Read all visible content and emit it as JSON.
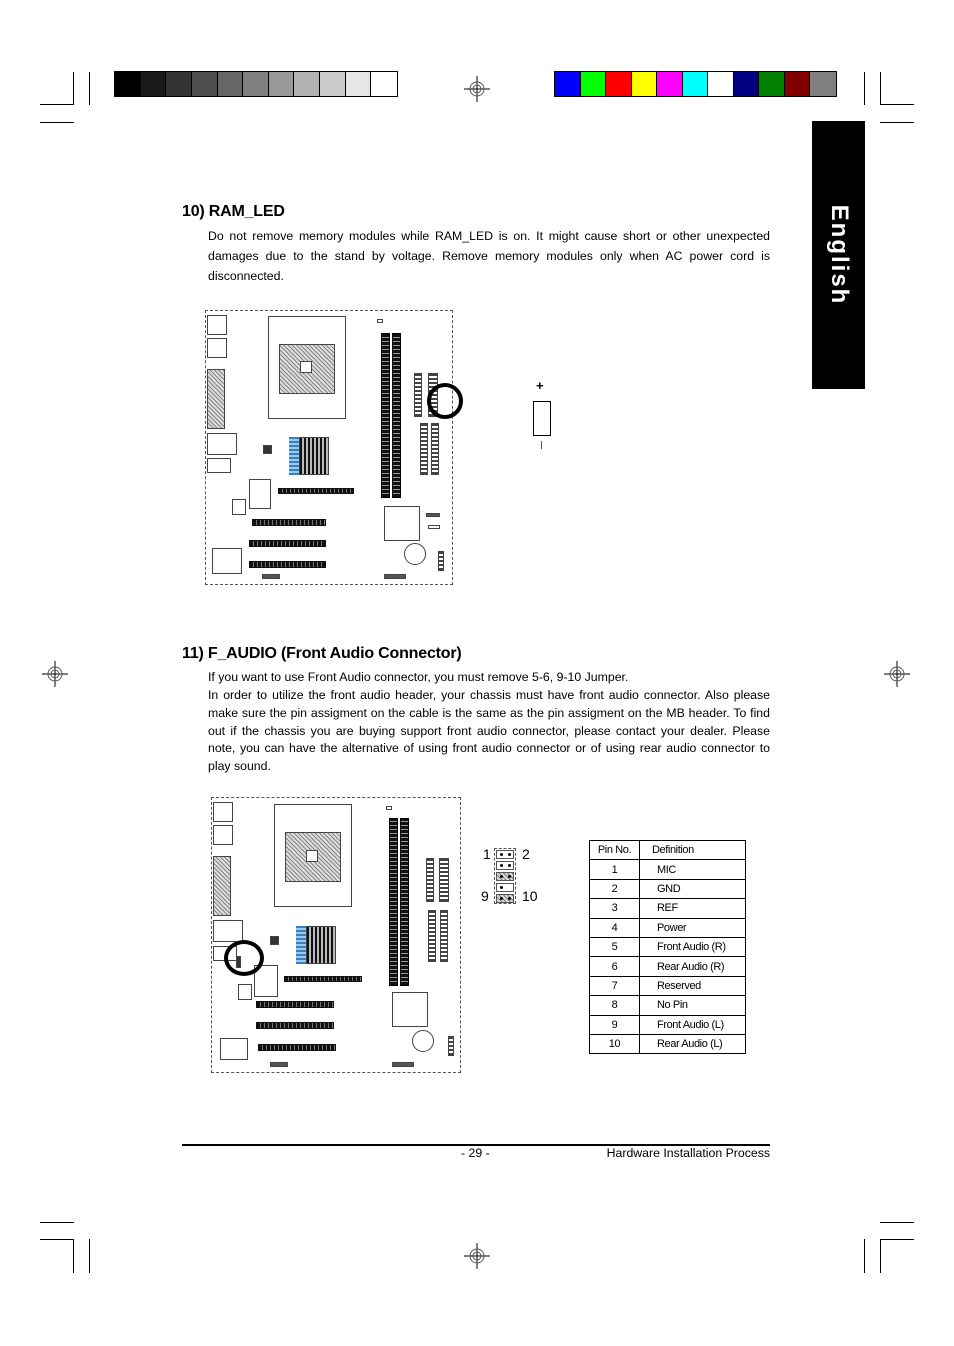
{
  "print_marks": {
    "grayscale_swatches": [
      "#000000",
      "#1a1a1a",
      "#333333",
      "#4d4d4d",
      "#666666",
      "#808080",
      "#999999",
      "#b3b3b3",
      "#cccccc",
      "#e6e6e6",
      "#ffffff"
    ],
    "color_swatches": [
      "#0000ff",
      "#00ff00",
      "#ff0000",
      "#ffff00",
      "#ff00ff",
      "#00ffff",
      "#ffffff",
      "#000080",
      "#008000",
      "#800000",
      "#808080"
    ]
  },
  "side_tab": {
    "label": "English"
  },
  "sections": [
    {
      "heading": "10) RAM_LED",
      "paragraphs": [
        "Do not remove memory modules while RAM_LED is on. It might cause short or other unexpected damages due to the stand by voltage. Remove memory modules only when AC power cord is disconnected."
      ],
      "led_symbol": {
        "plus": "+",
        "minus": "-"
      }
    },
    {
      "heading": "11) F_AUDIO (Front Audio Connector)",
      "paragraphs": [
        "If you want to use Front Audio connector, you must remove 5-6, 9-10 Jumper.",
        "In order to utilize the front audio header, your chassis must have front audio connector. Also please make sure the pin assigment on the cable is the same as the pin assigment on the MB header. To find out if the chassis you are buying support front audio connector, please contact your dealer. Please note, you can have the alternative of using front audio connector or of using rear audio connector to play sound."
      ],
      "header_labels": {
        "top_left": "1",
        "top_right": "2",
        "bottom_left": "9",
        "bottom_right": "10"
      },
      "pin_table": {
        "headers": [
          "Pin No.",
          "Definition"
        ],
        "rows": [
          [
            "1",
            "MIC"
          ],
          [
            "2",
            "GND"
          ],
          [
            "3",
            "REF"
          ],
          [
            "4",
            "Power"
          ],
          [
            "5",
            "Front Audio (R)"
          ],
          [
            "6",
            "Rear Audio (R)"
          ],
          [
            "7",
            "Reserved"
          ],
          [
            "8",
            "No Pin"
          ],
          [
            "9",
            "Front Audio (L)"
          ],
          [
            "10",
            "Rear Audio (L)"
          ]
        ]
      }
    }
  ],
  "footer": {
    "page_number": "- 29 -",
    "title": "Hardware Installation Process"
  }
}
